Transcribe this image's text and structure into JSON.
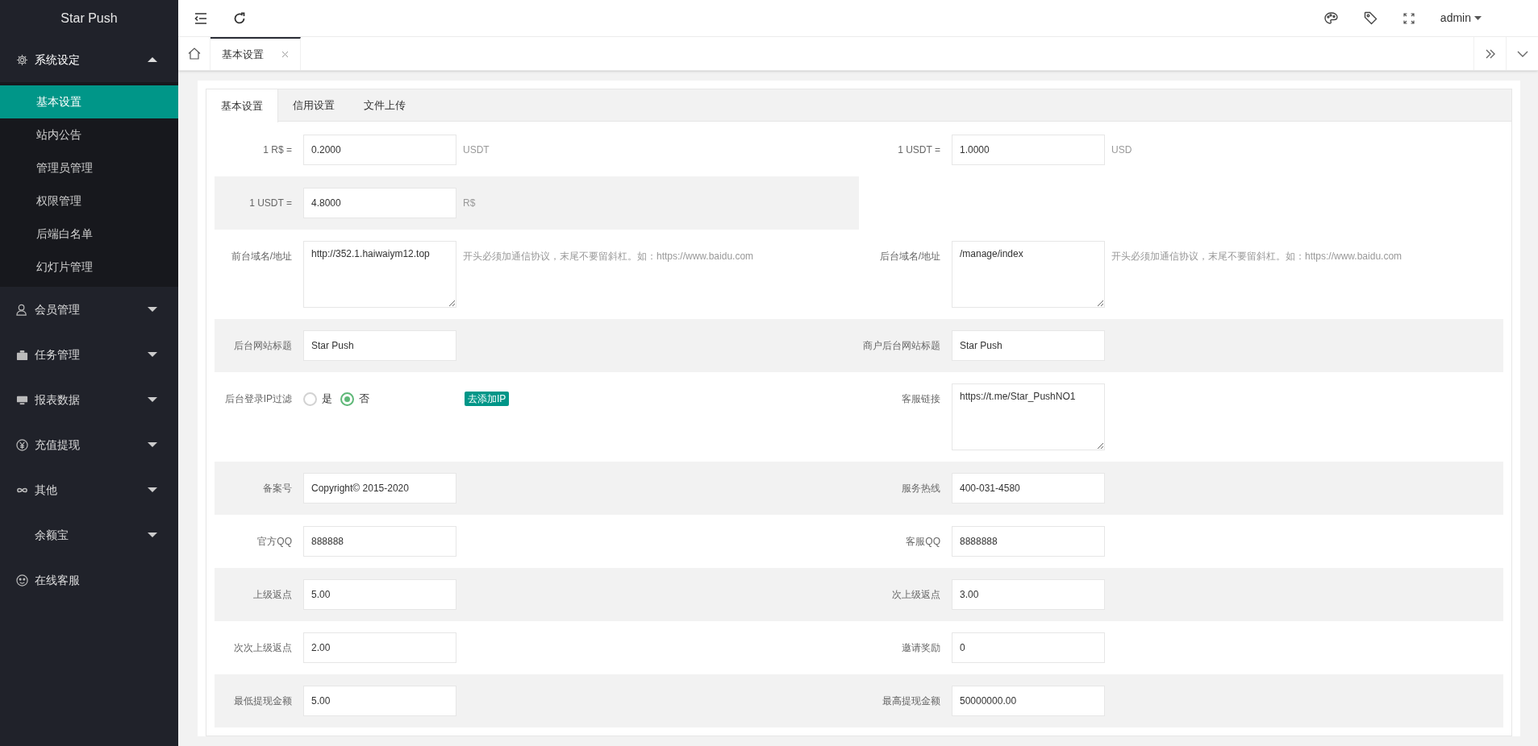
{
  "sidebar": {
    "logo": "Star Push",
    "groups": [
      {
        "label": "系统设定",
        "expanded": true,
        "children": [
          {
            "label": "基本设置",
            "selected": true
          },
          {
            "label": "站内公告",
            "selected": false
          },
          {
            "label": "管理员管理",
            "selected": false
          },
          {
            "label": "权限管理",
            "selected": false
          },
          {
            "label": "后端白名单",
            "selected": false
          },
          {
            "label": "幻灯片管理",
            "selected": false
          }
        ]
      },
      {
        "label": "会员管理",
        "expanded": false
      },
      {
        "label": "任务管理",
        "expanded": false
      },
      {
        "label": "报表数据",
        "expanded": false
      },
      {
        "label": "充值提现",
        "expanded": false
      },
      {
        "label": "其他",
        "expanded": false
      },
      {
        "label": "余额宝",
        "expanded": false
      },
      {
        "label": "在线客服"
      }
    ]
  },
  "header": {
    "user": "admin"
  },
  "page_tabs": [
    {
      "label": "基本设置",
      "selected": true
    }
  ],
  "form_tabs": [
    {
      "label": "基本设置",
      "selected": true
    },
    {
      "label": "信用设置",
      "selected": false
    },
    {
      "label": "文件上传",
      "selected": false
    }
  ],
  "rows": [
    {
      "left": {
        "kind": "input",
        "label": "1 R$ =",
        "value": "0.2000",
        "unit": "USDT"
      },
      "right": {
        "kind": "input",
        "label": "1 USDT =",
        "value": "1.0000",
        "unit": "USD"
      }
    },
    {
      "left": {
        "kind": "input",
        "label": "1 USDT =",
        "value": "4.8000",
        "unit": "R$"
      },
      "right": null
    },
    {
      "left": {
        "kind": "textarea",
        "label": "前台域名/地址",
        "value": "http://352.1.haiwaiym12.top",
        "unit": "开头必须加通信协议，末尾不要留斜杠。如：https://www.baidu.com"
      },
      "right": {
        "kind": "textarea",
        "label": "后台域名/地址",
        "value": "/manage/index",
        "unit": "开头必须加通信协议，末尾不要留斜杠。如：https://www.baidu.com"
      }
    },
    {
      "left": {
        "kind": "input",
        "label": "后台网站标题",
        "value": "Star Push"
      },
      "right": {
        "kind": "input",
        "label": "商户后台网站标题",
        "value": "Star Push"
      }
    },
    {
      "left": {
        "kind": "radio",
        "label": "后台登录IP过滤",
        "options": [
          {
            "label": "是",
            "selected": false
          },
          {
            "label": "否",
            "selected": true
          }
        ],
        "button": "去添加IP"
      },
      "right": {
        "kind": "textarea",
        "label": "客服链接",
        "value": "https://t.me/Star_PushNO1"
      }
    },
    {
      "left": {
        "kind": "input",
        "label": "备案号",
        "value": "Copyright© 2015-2020"
      },
      "right": {
        "kind": "input",
        "label": "服务热线",
        "value": "400-031-4580"
      }
    },
    {
      "left": {
        "kind": "input",
        "label": "官方QQ",
        "value": "888888"
      },
      "right": {
        "kind": "input",
        "label": "客服QQ",
        "value": "8888888"
      }
    },
    {
      "left": {
        "kind": "input",
        "label": "上级返点",
        "value": "5.00"
      },
      "right": {
        "kind": "input",
        "label": "次上级返点",
        "value": "3.00"
      }
    },
    {
      "left": {
        "kind": "input",
        "label": "次次上级返点",
        "value": "2.00"
      },
      "right": {
        "kind": "input",
        "label": "邀请奖励",
        "value": "0"
      }
    },
    {
      "left": {
        "kind": "input",
        "label": "最低提现金额",
        "value": "5.00"
      },
      "right": {
        "kind": "input",
        "label": "最高提现金额",
        "value": "50000000.00"
      }
    }
  ]
}
